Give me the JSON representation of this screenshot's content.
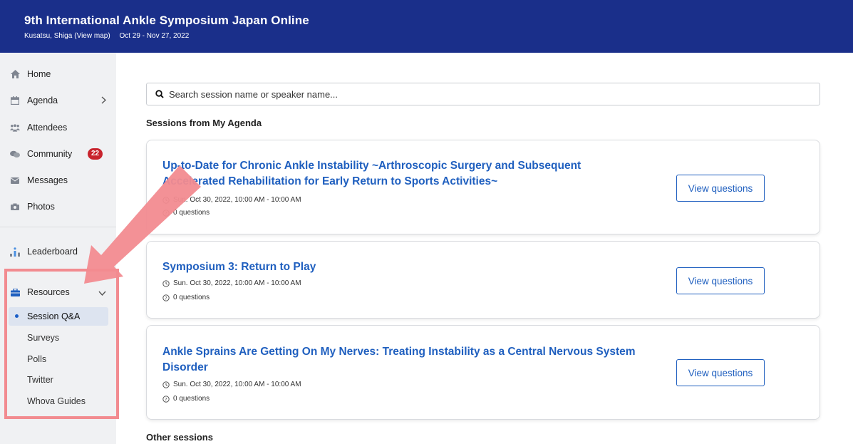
{
  "header": {
    "title": "9th International Ankle Symposium Japan Online",
    "location": "Kusatsu, Shiga",
    "map_link": "(View map)",
    "dates": "Oct 29 - Nov 27, 2022"
  },
  "sidebar": {
    "home": "Home",
    "agenda": "Agenda",
    "attendees": "Attendees",
    "community": "Community",
    "community_badge": "22",
    "messages": "Messages",
    "photos": "Photos",
    "leaderboard": "Leaderboard",
    "resources": "Resources",
    "resource_items": [
      "Session Q&A",
      "Surveys",
      "Polls",
      "Twitter",
      "Whova Guides"
    ]
  },
  "search": {
    "placeholder": "Search session name or speaker name..."
  },
  "sections": {
    "my_agenda": "Sessions from My Agenda",
    "other": "Other sessions"
  },
  "sessions": [
    {
      "title_line1": "Up-to-Date for Chronic Ankle Instability ~Arthroscopic Surgery and Subsequent",
      "title_line2": "Accelerated Rehabilitation for Early Return to Sports Activities~",
      "time": "Sun. Oct 30, 2022, 10:00 AM - 10:00 AM",
      "questions": "0 questions",
      "button": "View questions"
    },
    {
      "title_line1": "Symposium 3: Return to Play",
      "title_line2": "",
      "time": "Sun. Oct 30, 2022, 10:00 AM - 10:00 AM",
      "questions": "0 questions",
      "button": "View questions"
    },
    {
      "title_line1": "Ankle Sprains Are Getting On My Nerves: Treating Instability as a Central Nervous System",
      "title_line2": "Disorder",
      "time": "Sun. Oct 30, 2022, 10:00 AM - 10:00 AM",
      "questions": "0 questions",
      "button": "View questions"
    }
  ],
  "colors": {
    "header_bg": "#1a2f8a",
    "link_blue": "#1f5fbf",
    "badge_red": "#c8232c",
    "annotation_pink": "#f28b90"
  }
}
